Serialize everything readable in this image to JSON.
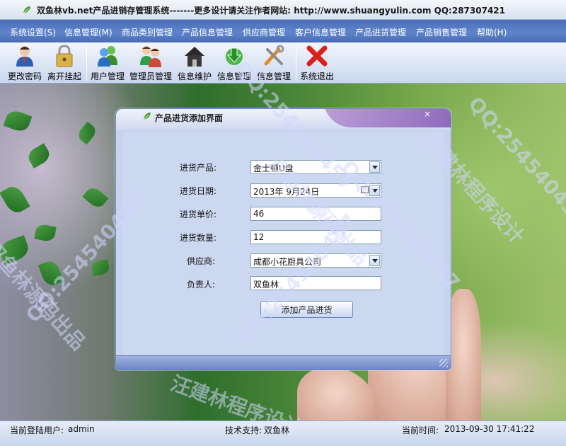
{
  "window": {
    "title": "双鱼林vb.net产品进销存管理系统-------更多设计请关注作者网站: http://www.shuangyulin.com QQ:287307421"
  },
  "menu": [
    "系统设置(S)",
    "信息管理(M)",
    "商品类别管理",
    "产品信息管理",
    "供应商管理",
    "客户信息管理",
    "产品进货管理",
    "产品销售管理",
    "帮助(H)"
  ],
  "toolbar": [
    {
      "label": "更改密码",
      "icon": "user-key-icon"
    },
    {
      "label": "离开挂起",
      "icon": "padlock-icon"
    },
    {
      "label": "用户管理",
      "icon": "users-icon"
    },
    {
      "label": "管理员管理",
      "icon": "admins-icon"
    },
    {
      "label": "信息维护",
      "icon": "home-icon"
    },
    {
      "label": "信息管理",
      "icon": "download-globe-icon"
    },
    {
      "label": "信息管理",
      "icon": "tools-icon"
    },
    {
      "label": "系统退出",
      "icon": "red-x-icon"
    }
  ],
  "dialog": {
    "title": "产品进货添加界面",
    "close": "×",
    "fields": {
      "product": {
        "label": "进货产品:",
        "value": "金士顿U盘"
      },
      "date": {
        "label": "进货日期:",
        "value": "2013年  9月24日"
      },
      "price": {
        "label": "进货单价:",
        "value": "46"
      },
      "quantity": {
        "label": "进货数量:",
        "value": "12"
      },
      "supplier": {
        "label": "供应商:",
        "value": "成都小花厨具公司"
      },
      "manager": {
        "label": "负责人:",
        "value": "双鱼林"
      }
    },
    "submit_label": "添加产品进货"
  },
  "status": {
    "user_label": "当前登陆用户:",
    "user": "admin",
    "support_label": "技术支持:",
    "support": "双鱼林",
    "time_label": "当前时间:",
    "time": "2013-09-30 17:41:22"
  },
  "watermarks": [
    "双鱼林源码出品",
    "QQ:254540457",
    "汪建林程序设计"
  ],
  "colors": {
    "menu": "#5577c0",
    "dialog": "#c7d3ef",
    "accent_purple": "#8a5bbd"
  }
}
